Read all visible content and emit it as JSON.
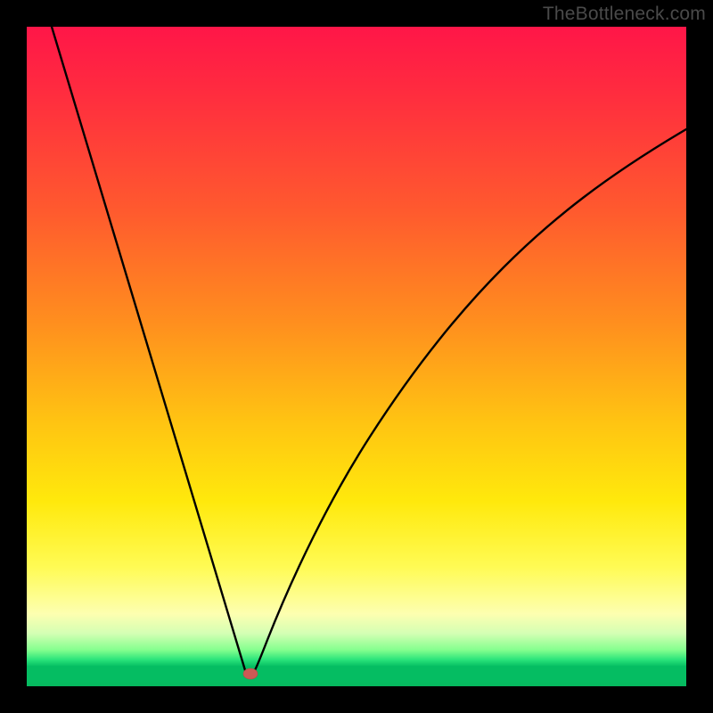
{
  "watermark": "TheBottleneck.com",
  "chart_data": {
    "type": "line",
    "title": "",
    "xlabel": "",
    "ylabel": "",
    "xlim": [
      0,
      1
    ],
    "ylim": [
      0,
      1
    ],
    "x": [
      0.0,
      0.05,
      0.1,
      0.15,
      0.2,
      0.25,
      0.3,
      0.335,
      0.35,
      0.37,
      0.4,
      0.45,
      0.5,
      0.55,
      0.6,
      0.65,
      0.7,
      0.75,
      0.8,
      0.85,
      0.9,
      0.95,
      1.0
    ],
    "values": [
      1.0,
      0.85,
      0.7,
      0.56,
      0.42,
      0.29,
      0.14,
      0.02,
      0.02,
      0.05,
      0.16,
      0.3,
      0.42,
      0.52,
      0.6,
      0.67,
      0.72,
      0.77,
      0.8,
      0.83,
      0.85,
      0.87,
      0.88
    ],
    "marker": {
      "x": 0.335,
      "y": 0.018
    },
    "gradient_stops": [
      {
        "pos": 0.0,
        "color": "#ff1648"
      },
      {
        "pos": 0.45,
        "color": "#ff8f1e"
      },
      {
        "pos": 0.72,
        "color": "#ffe90c"
      },
      {
        "pos": 0.92,
        "color": "#d4ffb4"
      },
      {
        "pos": 0.97,
        "color": "#05bd62"
      }
    ]
  }
}
